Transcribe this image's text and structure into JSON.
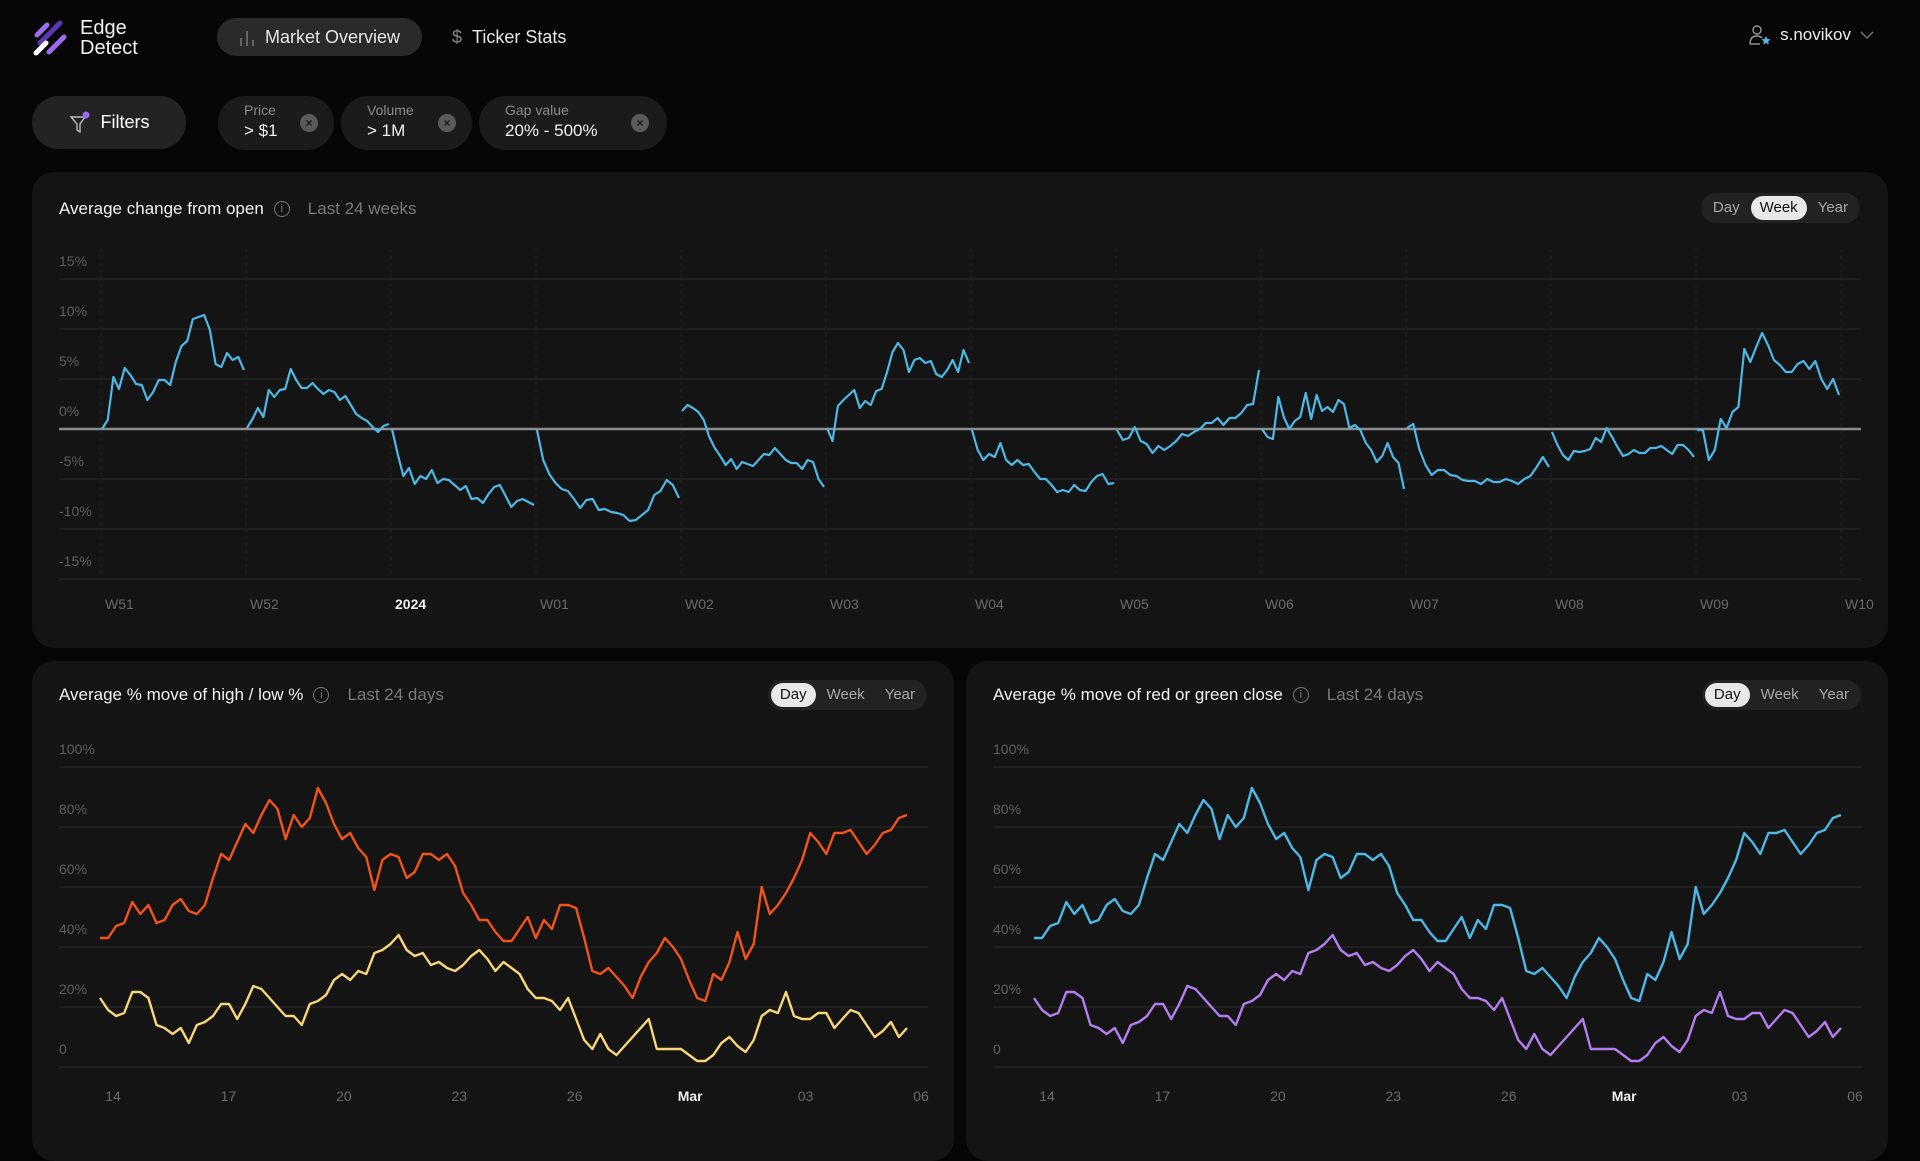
{
  "app": {
    "name_line1": "Edge",
    "name_line2": "Detect"
  },
  "nav": {
    "items": [
      {
        "label": "Market Overview",
        "icon": "bar-chart-icon",
        "active": true
      },
      {
        "label": "Ticker Stats",
        "icon": "dollar-icon",
        "active": false
      }
    ]
  },
  "user": {
    "name": "s.novikov",
    "icon": "user-star-icon"
  },
  "filters": {
    "button_label": "Filters",
    "chips": [
      {
        "label": "Price",
        "value": "> $1"
      },
      {
        "label": "Volume",
        "value": "> 1M"
      },
      {
        "label": "Gap value",
        "value": "20% - 500%"
      }
    ]
  },
  "colors": {
    "accent": "#8b5cf6",
    "blue": "#4fb8e6",
    "orange": "#f2541b",
    "yellow": "#f9d57a",
    "purple": "#b47ef0",
    "zero_line": "#8c8c8c"
  },
  "cards": [
    {
      "title": "Average change from open",
      "subtitle": "Last 24 weeks",
      "periods": [
        "Day",
        "Week",
        "Year"
      ],
      "selected": "Week"
    },
    {
      "title": "Average % move of high / low %",
      "subtitle": "Last 24 days",
      "periods": [
        "Day",
        "Week",
        "Year"
      ],
      "selected": "Day"
    },
    {
      "title": "Average % move of red or green close",
      "subtitle": "Last 24 days",
      "periods": [
        "Day",
        "Week",
        "Year"
      ],
      "selected": "Day"
    }
  ],
  "chart_data": [
    {
      "type": "line",
      "ylim": [
        -15,
        15
      ],
      "yticks": [
        "15%",
        "10%",
        "5%",
        "0%",
        "-5%",
        "-10%",
        "-15%"
      ],
      "ytick_values": [
        15,
        10,
        5,
        0,
        -5,
        -10,
        -15
      ],
      "xticks": [
        "W51",
        "W52",
        "2024",
        "W01",
        "W02",
        "W03",
        "W04",
        "W05",
        "W06",
        "W07",
        "W08",
        "W09",
        "W10"
      ],
      "highlight_xtick": "2024",
      "grid": true,
      "zero_line": true,
      "series": [
        {
          "color": "#4fb8e6",
          "segments": [
            [
              0,
              0.9,
              5.2,
              4,
              6.1,
              5.4,
              4.5,
              4.4,
              2.9,
              3.7,
              4.9,
              4.9,
              4.4,
              6.7,
              8.3,
              8.8,
              11,
              11.2,
              11.4,
              9.9,
              6.5,
              6.2,
              7.6,
              6.9,
              7.2,
              5.9
            ],
            [
              0.1,
              1,
              2.1,
              1.2,
              3.9,
              3.2,
              3.9,
              4,
              6,
              4.9,
              4.1,
              4.1,
              4.6,
              4,
              3.5,
              3.9,
              3.7,
              2.9,
              3.3,
              2.4,
              1.5,
              1.1,
              0.8,
              0.2,
              -0.3,
              0.3,
              0.5
            ],
            [
              0,
              -2.5,
              -4.7,
              -3.9,
              -5.5,
              -4.7,
              -5,
              -4.1,
              -5.4,
              -5,
              -5.1,
              -5.6,
              -6.1,
              -5.7,
              -7,
              -6.9,
              -7.4,
              -6.5,
              -5.8,
              -5.6,
              -6.7,
              -7.8,
              -7.2,
              -7,
              -7.3,
              -7.6
            ],
            [
              -0.1,
              -3.1,
              -4.5,
              -5.4,
              -6,
              -6.2,
              -7,
              -7.9,
              -7.1,
              -7,
              -8.1,
              -8,
              -8.3,
              -8.4,
              -8.6,
              -9.2,
              -9.1,
              -8.6,
              -8.1,
              -6.6,
              -6.2,
              -5.1,
              -5.6,
              -6.9
            ],
            [
              1.8,
              2.4,
              2.1,
              1.7,
              0.9,
              -0.8,
              -1.9,
              -2.7,
              -3.6,
              -3,
              -4,
              -3.3,
              -3.5,
              -3.7,
              -3.1,
              -2.5,
              -2.6,
              -1.9,
              -2.5,
              -3.1,
              -3.4,
              -3.4,
              -4,
              -3.1,
              -3.3,
              -5,
              -5.8
            ],
            [
              0.1,
              -1.2,
              2.3,
              2.9,
              3.4,
              3.9,
              2.1,
              2.8,
              2.4,
              3.8,
              4,
              5.7,
              7.7,
              8.6,
              7.9,
              5.7,
              6.9,
              7.1,
              6.6,
              6.8,
              5.5,
              5.2,
              5.9,
              6.9,
              5.7,
              7.9,
              6.6
            ],
            [
              -0.1,
              -2.1,
              -3.1,
              -2.5,
              -2.8,
              -1.4,
              -3.1,
              -3.6,
              -3.1,
              -3.6,
              -3.5,
              -4.3,
              -5,
              -5,
              -5.6,
              -6.3,
              -6.1,
              -6.3,
              -5.6,
              -6.1,
              -6.2,
              -5.3,
              -4.7,
              -4.5,
              -5.5,
              -5.4
            ],
            [
              -0.1,
              -1.1,
              -0.9,
              0.2,
              -1.2,
              -1.5,
              -2.4,
              -1.7,
              -2.1,
              -1.7,
              -1.2,
              -0.5,
              -0.7,
              -0.3,
              0,
              0.6,
              0.6,
              1.1,
              0.4,
              1.1,
              1.1,
              1.6,
              2.4,
              2.5,
              5.9
            ],
            [
              0,
              -0.8,
              -1,
              3.2,
              1.2,
              0,
              0.8,
              1.2,
              3.6,
              1,
              3.4,
              1.8,
              2.2,
              1.7,
              2.9,
              2.5,
              0.1,
              0.4,
              -0.1,
              -1.4,
              -2.1,
              -3.3,
              -2.7,
              -1.4,
              -2.8,
              -3.4,
              -6
            ],
            [
              0.1,
              0.5,
              -2,
              -3.6,
              -4.6,
              -4.1,
              -4.1,
              -4.6,
              -4.7,
              -5.1,
              -5.2,
              -5.2,
              -5.5,
              -5,
              -5.3,
              -5.3,
              -5,
              -5.2,
              -5.5,
              -5,
              -4.7,
              -3.8,
              -2.8,
              -3.8
            ],
            [
              -0.3,
              -1.6,
              -2.6,
              -3.1,
              -2.2,
              -2.3,
              -2.2,
              -2,
              -0.9,
              -1.3,
              0.1,
              -0.8,
              -1.8,
              -2.7,
              -2.5,
              -2.1,
              -2.4,
              -2.4,
              -1.9,
              -1.9,
              -1.7,
              -2.1,
              -2.5,
              -1.6,
              -1.6,
              -2.1,
              -2.8
            ],
            [
              -0.1,
              -0.1,
              -3.1,
              -2.1,
              1,
              0.1,
              1.7,
              2.2,
              8,
              6.7,
              8.2,
              9.6,
              8.4,
              6.9,
              6.4,
              5.7,
              5.7,
              6.5,
              6.8,
              6,
              6.8,
              5,
              4,
              5,
              3.4
            ]
          ]
        }
      ]
    },
    {
      "type": "line",
      "ylim": [
        0,
        100
      ],
      "yticks": [
        "100%",
        "80%",
        "60%",
        "40%",
        "20%",
        "0"
      ],
      "ytick_values": [
        100,
        80,
        60,
        40,
        20,
        0
      ],
      "xticks": [
        "14",
        "17",
        "20",
        "23",
        "26",
        "Mar",
        "03",
        "06"
      ],
      "highlight_xtick": "Mar",
      "grid": true,
      "series": [
        {
          "color": "#f2541b",
          "values": [
            43,
            43,
            47,
            48,
            55,
            51,
            54,
            48,
            49,
            54,
            56,
            52,
            51,
            54,
            63,
            71,
            69,
            75,
            81,
            78,
            84,
            89,
            86,
            76,
            84,
            80,
            83,
            93,
            88,
            81,
            76,
            78,
            73,
            70,
            59,
            69,
            71,
            70,
            63,
            65,
            71,
            71,
            69,
            71,
            67,
            58,
            54,
            49,
            49,
            45,
            42,
            42,
            46,
            50,
            43,
            49,
            46,
            54,
            54,
            53,
            43,
            32,
            31,
            33,
            30,
            27,
            23,
            30,
            35,
            38,
            43,
            40,
            36,
            29,
            23,
            22,
            31,
            29,
            35,
            45,
            36,
            41,
            60,
            51,
            54,
            58,
            63,
            69,
            78,
            75,
            71,
            78,
            78,
            79,
            75,
            71,
            74,
            78,
            79,
            83,
            84
          ]
        },
        {
          "color": "#f9d57a",
          "values": [
            23,
            19,
            17,
            18,
            25,
            25,
            23,
            14,
            13,
            11,
            13,
            8,
            14,
            15,
            17,
            21,
            21,
            16,
            21,
            27,
            26,
            23,
            20,
            17,
            17,
            14,
            21,
            22,
            24,
            29,
            31,
            29,
            32,
            31,
            38,
            39,
            41,
            44,
            39,
            37,
            38,
            34,
            35,
            33,
            32,
            34,
            37,
            39,
            36,
            32,
            35,
            33,
            31,
            26,
            23,
            23,
            22,
            19,
            23,
            16,
            9,
            6,
            11,
            6,
            4,
            7,
            10,
            13,
            16,
            6,
            6,
            6,
            6,
            4,
            2,
            2,
            4,
            8,
            10,
            7,
            5,
            9,
            17,
            19,
            18,
            25,
            17,
            16,
            16,
            18,
            18,
            13,
            16,
            19,
            18,
            14,
            10,
            12,
            15,
            10,
            13
          ]
        }
      ]
    },
    {
      "type": "line",
      "ylim": [
        0,
        100
      ],
      "yticks": [
        "100%",
        "80%",
        "60%",
        "40%",
        "20%",
        "0"
      ],
      "ytick_values": [
        100,
        80,
        60,
        40,
        20,
        0
      ],
      "xticks": [
        "14",
        "17",
        "20",
        "23",
        "26",
        "Mar",
        "03",
        "06"
      ],
      "highlight_xtick": "Mar",
      "grid": true,
      "series": [
        {
          "color": "#4fb8e6",
          "values": [
            43,
            43,
            47,
            48,
            55,
            51,
            54,
            48,
            49,
            54,
            56,
            52,
            51,
            54,
            63,
            71,
            69,
            75,
            81,
            78,
            84,
            89,
            86,
            76,
            84,
            80,
            83,
            93,
            88,
            81,
            76,
            78,
            73,
            70,
            59,
            69,
            71,
            70,
            63,
            65,
            71,
            71,
            69,
            71,
            67,
            58,
            54,
            49,
            49,
            45,
            42,
            42,
            46,
            50,
            43,
            49,
            46,
            54,
            54,
            53,
            43,
            32,
            31,
            33,
            30,
            27,
            23,
            30,
            35,
            38,
            43,
            40,
            36,
            29,
            23,
            22,
            31,
            29,
            35,
            45,
            36,
            41,
            60,
            51,
            54,
            58,
            63,
            69,
            78,
            75,
            71,
            78,
            78,
            79,
            75,
            71,
            74,
            78,
            79,
            83,
            84
          ]
        },
        {
          "color": "#b47ef0",
          "values": [
            23,
            19,
            17,
            18,
            25,
            25,
            23,
            14,
            13,
            11,
            13,
            8,
            14,
            15,
            17,
            21,
            21,
            16,
            21,
            27,
            26,
            23,
            20,
            17,
            17,
            14,
            21,
            22,
            24,
            29,
            31,
            29,
            32,
            31,
            38,
            39,
            41,
            44,
            39,
            37,
            38,
            34,
            35,
            33,
            32,
            34,
            37,
            39,
            36,
            32,
            35,
            33,
            31,
            26,
            23,
            23,
            22,
            19,
            23,
            16,
            9,
            6,
            11,
            6,
            4,
            7,
            10,
            13,
            16,
            6,
            6,
            6,
            6,
            4,
            2,
            2,
            4,
            8,
            10,
            7,
            5,
            9,
            17,
            19,
            18,
            25,
            17,
            16,
            16,
            18,
            18,
            13,
            16,
            19,
            18,
            14,
            10,
            12,
            15,
            10,
            13
          ]
        }
      ]
    }
  ]
}
